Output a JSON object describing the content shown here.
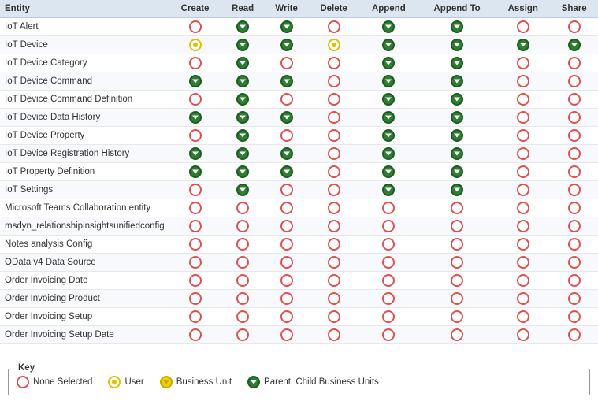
{
  "header": {
    "columns": [
      "Entity",
      "Create",
      "Read",
      "Write",
      "Delete",
      "Append",
      "Append To",
      "Assign",
      "Share"
    ]
  },
  "rows": [
    {
      "entity": "IoT Alert",
      "create": "none",
      "read": "parent",
      "write": "parent",
      "delete": "none",
      "append": "parent",
      "appendTo": "parent",
      "assign": "none",
      "share": "none"
    },
    {
      "entity": "IoT Device",
      "create": "user",
      "read": "parent",
      "write": "parent",
      "delete": "user",
      "append": "parent",
      "appendTo": "parent",
      "assign": "parent",
      "share": "parent"
    },
    {
      "entity": "IoT Device Category",
      "create": "none",
      "read": "parent",
      "write": "none",
      "delete": "none",
      "append": "parent",
      "appendTo": "parent",
      "assign": "none",
      "share": "none"
    },
    {
      "entity": "IoT Device Command",
      "create": "parent",
      "read": "parent",
      "write": "parent",
      "delete": "none",
      "append": "parent",
      "appendTo": "parent",
      "assign": "none",
      "share": "none"
    },
    {
      "entity": "IoT Device Command Definition",
      "create": "none",
      "read": "parent",
      "write": "none",
      "delete": "none",
      "append": "parent",
      "appendTo": "parent",
      "assign": "none",
      "share": "none"
    },
    {
      "entity": "IoT Device Data History",
      "create": "parent",
      "read": "parent",
      "write": "parent",
      "delete": "none",
      "append": "parent",
      "appendTo": "parent",
      "assign": "none",
      "share": "none"
    },
    {
      "entity": "IoT Device Property",
      "create": "none",
      "read": "parent",
      "write": "none",
      "delete": "none",
      "append": "parent",
      "appendTo": "parent",
      "assign": "none",
      "share": "none"
    },
    {
      "entity": "IoT Device Registration History",
      "create": "parent",
      "read": "parent",
      "write": "parent",
      "delete": "none",
      "append": "parent",
      "appendTo": "parent",
      "assign": "none",
      "share": "none"
    },
    {
      "entity": "IoT Property Definition",
      "create": "parent",
      "read": "parent",
      "write": "parent",
      "delete": "none",
      "append": "parent",
      "appendTo": "parent",
      "assign": "none",
      "share": "none"
    },
    {
      "entity": "IoT Settings",
      "create": "none",
      "read": "parent",
      "write": "none",
      "delete": "none",
      "append": "parent",
      "appendTo": "parent",
      "assign": "none",
      "share": "none"
    },
    {
      "entity": "Microsoft Teams Collaboration entity",
      "create": "none",
      "read": "none",
      "write": "none",
      "delete": "none",
      "append": "none",
      "appendTo": "none",
      "assign": "none",
      "share": "none"
    },
    {
      "entity": "msdyn_relationshipinsightsunifiedconfig",
      "create": "none",
      "read": "none",
      "write": "none",
      "delete": "none",
      "append": "none",
      "appendTo": "none",
      "assign": "none",
      "share": "none"
    },
    {
      "entity": "Notes analysis Config",
      "create": "none",
      "read": "none",
      "write": "none",
      "delete": "none",
      "append": "none",
      "appendTo": "none",
      "assign": "none",
      "share": "none"
    },
    {
      "entity": "OData v4 Data Source",
      "create": "none",
      "read": "none",
      "write": "none",
      "delete": "none",
      "append": "none",
      "appendTo": "none",
      "assign": "none",
      "share": "none"
    },
    {
      "entity": "Order Invoicing Date",
      "create": "none",
      "read": "none",
      "write": "none",
      "delete": "none",
      "append": "none",
      "appendTo": "none",
      "assign": "none",
      "share": "none"
    },
    {
      "entity": "Order Invoicing Product",
      "create": "none",
      "read": "none",
      "write": "none",
      "delete": "none",
      "append": "none",
      "appendTo": "none",
      "assign": "none",
      "share": "none"
    },
    {
      "entity": "Order Invoicing Setup",
      "create": "none",
      "read": "none",
      "write": "none",
      "delete": "none",
      "append": "none",
      "appendTo": "none",
      "assign": "none",
      "share": "none"
    },
    {
      "entity": "Order Invoicing Setup Date",
      "create": "none",
      "read": "none",
      "write": "none",
      "delete": "none",
      "append": "none",
      "appendTo": "none",
      "assign": "none",
      "share": "none"
    }
  ],
  "key": {
    "title": "Key",
    "items": [
      {
        "label": "None Selected",
        "type": "none"
      },
      {
        "label": "User",
        "type": "user"
      },
      {
        "label": "Business Unit",
        "type": "business"
      },
      {
        "label": "Parent: Child Business Units",
        "type": "parent"
      }
    ]
  }
}
